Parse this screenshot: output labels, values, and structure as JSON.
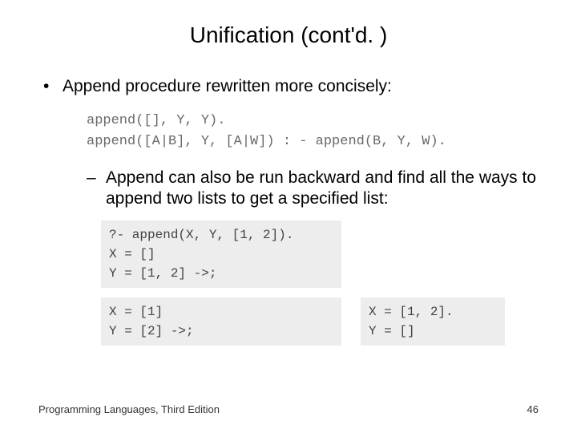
{
  "title": "Unification (cont'd. )",
  "bullet1": "Append procedure rewritten more concisely:",
  "code_lines": {
    "l1": "append([], Y, Y).",
    "l2": "append([A|B], Y, [A|W]) : - append(B, Y, W)."
  },
  "bullet2": "Append can also be run backward and find all the ways to append two lists to get a specified list:",
  "box_a": "?- append(X, Y, [1, 2]).\nX = []\nY = [1, 2] ->;",
  "box_b": "X = [1]\nY = [2] ->;",
  "box_c": "X = [1, 2].\nY = []",
  "footer_left": "Programming Languages, Third Edition",
  "footer_right": "46"
}
